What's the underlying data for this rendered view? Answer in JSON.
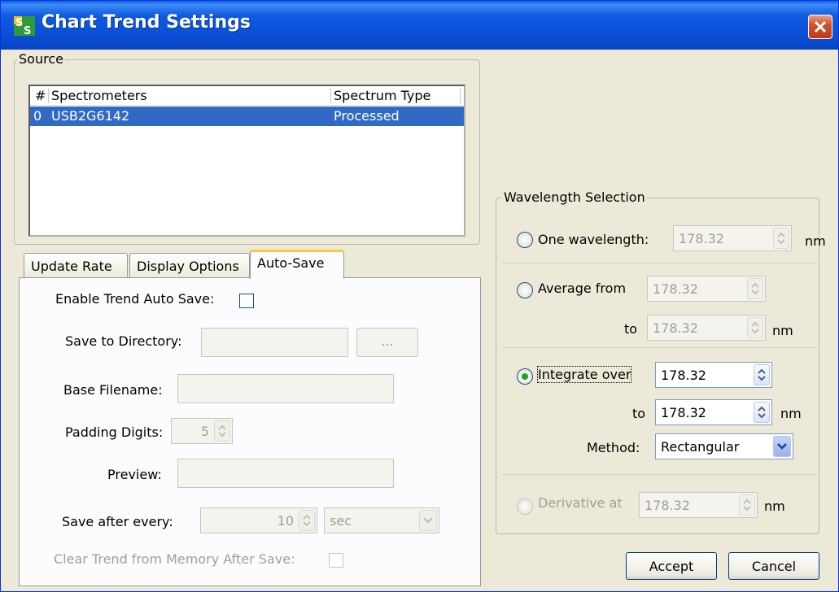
{
  "window": {
    "title": "Chart Trend Settings",
    "icon": "spectrasuite-app-icon"
  },
  "source": {
    "legend": "Source",
    "columns": [
      "#",
      "Spectrometers",
      "Spectrum Type"
    ],
    "rows": [
      {
        "num": "0",
        "spectrometer": "USB2G6142",
        "type": "Processed"
      }
    ]
  },
  "tabs": [
    {
      "label": "Update Rate",
      "selected": false
    },
    {
      "label": "Display Options",
      "selected": false
    },
    {
      "label": "Auto-Save",
      "selected": true
    }
  ],
  "autosave": {
    "enable_label": "Enable Trend Auto Save:",
    "enable_checked": false,
    "dir_label": "Save to Directory:",
    "dir_value": "",
    "browse_label": "...",
    "base_label": "Base Filename:",
    "base_value": "",
    "padding_label": "Padding Digits:",
    "padding_value": "5",
    "preview_label": "Preview:",
    "preview_value": "",
    "every_label": "Save after every:",
    "every_value": "10",
    "unit_value": "sec",
    "clear_label": "Clear Trend from Memory After Save:",
    "clear_checked": false
  },
  "wavelength": {
    "legend": "Wavelength Selection",
    "one_label": "One wavelength:",
    "one_value": "178.32",
    "avg_label": "Average from",
    "avg_from": "178.32",
    "avg_to": "178.32",
    "int_label": "Integrate over",
    "int_from": "178.32",
    "int_to": "178.32",
    "method_label": "Method:",
    "method_value": "Rectangular",
    "deriv_label": "Derivative at",
    "deriv_value": "178.32",
    "to_label": "to",
    "unit": "nm",
    "selected_mode": "Integrate over"
  },
  "buttons": {
    "accept": "Accept",
    "cancel": "Cancel"
  },
  "colors": {
    "selection": "#316ac5",
    "title_bar": "#0a4fd6",
    "radio_dot": "#21a121",
    "tab_highlight": "#ffc73c"
  }
}
